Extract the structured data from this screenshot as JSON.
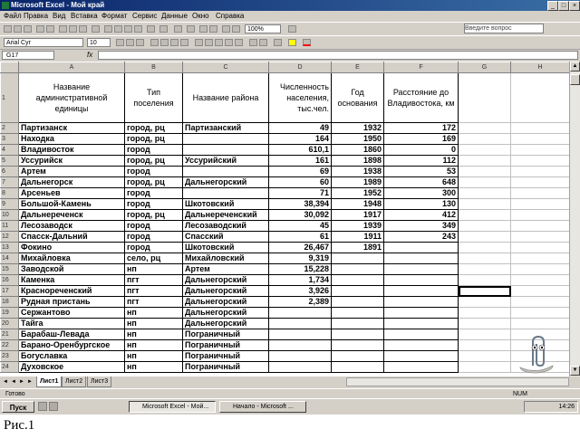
{
  "window": {
    "title": "Microsoft Excel - Мой край",
    "min": "_",
    "max": "□",
    "close": "×"
  },
  "menu": [
    "Файл",
    "Правка",
    "Вид",
    "Вставка",
    "Формат",
    "Сервис",
    "Данные",
    "Окно",
    "Справка"
  ],
  "help_placeholder": "Введите вопрос",
  "toolbar": {
    "zoom": "100%",
    "font": "Arial Cyr",
    "size": "10"
  },
  "name_box": "G17",
  "fx": "fx",
  "columns": [
    "A",
    "B",
    "C",
    "D",
    "E",
    "F",
    "G",
    "H"
  ],
  "header": [
    "Название административной единицы",
    "Тип поселения",
    "Название района",
    "Численность населения, тыс.чел.",
    "Год основания",
    "Расстояние до Владивостока, км"
  ],
  "rows": [
    {
      "n": "2",
      "a": "Партизанск",
      "b": "город, рц",
      "c": "Партизанский",
      "d": "49",
      "e": "1932",
      "f": "172"
    },
    {
      "n": "3",
      "a": "Находка",
      "b": "город, рц",
      "c": "",
      "d": "164",
      "e": "1950",
      "f": "169"
    },
    {
      "n": "4",
      "a": "Владивосток",
      "b": "город",
      "c": "",
      "d": "610,1",
      "e": "1860",
      "f": "0"
    },
    {
      "n": "5",
      "a": "Уссурийск",
      "b": "город, рц",
      "c": "Уссурийский",
      "d": "161",
      "e": "1898",
      "f": "112"
    },
    {
      "n": "6",
      "a": "Артем",
      "b": "город",
      "c": "",
      "d": "69",
      "e": "1938",
      "f": "53"
    },
    {
      "n": "7",
      "a": "Дальнегорск",
      "b": "город, рц",
      "c": "Дальнегорский",
      "d": "60",
      "e": "1989",
      "f": "648"
    },
    {
      "n": "8",
      "a": "Арсеньев",
      "b": "город",
      "c": "",
      "d": "71",
      "e": "1952",
      "f": "300"
    },
    {
      "n": "9",
      "a": "Большой-Камень",
      "b": "город",
      "c": "Шкотовский",
      "d": "38,394",
      "e": "1948",
      "f": "130"
    },
    {
      "n": "10",
      "a": "Дальнереченск",
      "b": "город, рц",
      "c": "Дальнереченский",
      "d": "30,092",
      "e": "1917",
      "f": "412"
    },
    {
      "n": "11",
      "a": "Лесозаводск",
      "b": "город",
      "c": "Лесозаводский",
      "d": "45",
      "e": "1939",
      "f": "349"
    },
    {
      "n": "12",
      "a": "Спасск-Дальний",
      "b": "город",
      "c": "Спасский",
      "d": "61",
      "e": "1911",
      "f": "243"
    },
    {
      "n": "13",
      "a": "Фокино",
      "b": "город",
      "c": "Шкотовский",
      "d": "26,467",
      "e": "1891",
      "f": ""
    },
    {
      "n": "14",
      "a": "Михайловка",
      "b": "село, рц",
      "c": "Михайловский",
      "d": "9,319",
      "e": "",
      "f": ""
    },
    {
      "n": "15",
      "a": "Заводской",
      "b": "нп",
      "c": "Артем",
      "d": "15,228",
      "e": "",
      "f": ""
    },
    {
      "n": "16",
      "a": "Каменка",
      "b": "пгт",
      "c": "Дальнегорский",
      "d": "1,734",
      "e": "",
      "f": ""
    },
    {
      "n": "17",
      "a": "Краснореченский",
      "b": "пгт",
      "c": "Дальнегорский",
      "d": "3,926",
      "e": "",
      "f": ""
    },
    {
      "n": "18",
      "a": "Рудная пристань",
      "b": "пгт",
      "c": "Дальнегорский",
      "d": "2,389",
      "e": "",
      "f": ""
    },
    {
      "n": "19",
      "a": "Сержантово",
      "b": "нп",
      "c": "Дальнегорский",
      "d": "",
      "e": "",
      "f": ""
    },
    {
      "n": "20",
      "a": "Тайга",
      "b": "нп",
      "c": "Дальнегорский",
      "d": "",
      "e": "",
      "f": ""
    },
    {
      "n": "21",
      "a": "Барабаш-Левада",
      "b": "нп",
      "c": "Пограничный",
      "d": "",
      "e": "",
      "f": ""
    },
    {
      "n": "22",
      "a": "Барано-Оренбургское",
      "b": "нп",
      "c": "Пограничный",
      "d": "",
      "e": "",
      "f": ""
    },
    {
      "n": "23",
      "a": "Богуславка",
      "b": "нп",
      "c": "Пограничный",
      "d": "",
      "e": "",
      "f": ""
    },
    {
      "n": "24",
      "a": "Духовское",
      "b": "нп",
      "c": "Пограничный",
      "d": "",
      "e": "",
      "f": ""
    }
  ],
  "sheets": [
    "Лист1",
    "Лист2",
    "Лист3"
  ],
  "status": {
    "left": "Готово",
    "right": "NUM"
  },
  "taskbar": {
    "start": "Пуск",
    "tasks": [
      "Microsoft Excel - Мой...",
      "Начало - Microsoft ..."
    ],
    "clock": "14:26"
  },
  "caption": "Рис.1"
}
